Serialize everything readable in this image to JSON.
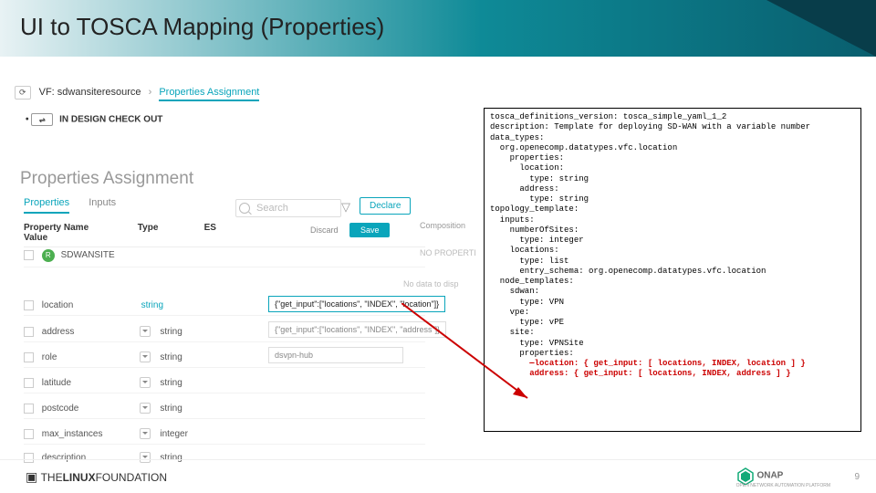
{
  "slide": {
    "title": "UI to TOSCA Mapping (Properties)",
    "page": "9"
  },
  "breadcrumb": {
    "vf_label": "VF:",
    "vf_value": "sdwansiteresource",
    "active": "Properties Assignment"
  },
  "checkout": {
    "label": "IN DESIGN CHECK OUT"
  },
  "panel": {
    "heading": "Properties Assignment",
    "tabs": {
      "properties": "Properties",
      "inputs": "Inputs"
    },
    "search_placeholder": "Search",
    "declare": "Declare",
    "headers": {
      "name": "Property Name",
      "type": "Type",
      "es": "ES",
      "value": "Value"
    },
    "buttons": {
      "discard": "Discard",
      "save": "Save"
    },
    "composition_label": "Composition",
    "no_properties": "NO PROPERTI",
    "no_data": "No data to disp"
  },
  "rows": {
    "r0": {
      "badge": "R",
      "name": "SDWANSITE"
    },
    "r1": {
      "name": "location",
      "type": "string"
    },
    "r2": {
      "name": "address",
      "type": "string"
    },
    "r3": {
      "name": "role",
      "type": "string"
    },
    "r4": {
      "name": "latitude",
      "type": "string"
    },
    "r5": {
      "name": "postcode",
      "type": "string"
    },
    "r6": {
      "name": "max_instances",
      "type": "integer"
    },
    "r7": {
      "name": "description",
      "type": "string"
    }
  },
  "values": {
    "v1": "{\"get_input\":[\"locations\", \"INDEX\", \"location\"]}",
    "v2": "{\"get_input\":[\"locations\", \"INDEX\", \"address\"]}",
    "v3": "dsvpn-hub"
  },
  "yaml": {
    "l1": "tosca_definitions_version: tosca_simple_yaml_1_2",
    "l2": "description: Template for deploying SD-WAN with a variable number",
    "l3": "data_types:",
    "l4": "  org.openecomp.datatypes.vfc.location",
    "l5": "    properties:",
    "l6": "      location:",
    "l7": "        type: string",
    "l8": "      address:",
    "l9": "        type: string",
    "l10": "topology_template:",
    "l11": "  inputs:",
    "l12": "    numberOfSites:",
    "l13": "      type: integer",
    "l14": "    locations:",
    "l15": "      type: list",
    "l16": "      entry_schema: org.openecomp.datatypes.vfc.location",
    "l17": "  node_templates:",
    "l18": "    sdwan:",
    "l19": "      type: VPN",
    "l20": "    vpe:",
    "l21": "      type: vPE",
    "l22": "    site:",
    "l23": "      type: VPNSite",
    "l24": "      properties:",
    "l25a": "        ",
    "l25b": "location: { get_input: [ locations, INDEX, location ] }",
    "l26a": "        ",
    "l26b": "address: { get_input: [ locations, INDEX, address ] }"
  },
  "footer": {
    "linux": "THE LINUX FOUNDATION",
    "onap": "ONAP",
    "onap_tag": "OPEN NETWORK AUTOMATION PLATFORM"
  }
}
